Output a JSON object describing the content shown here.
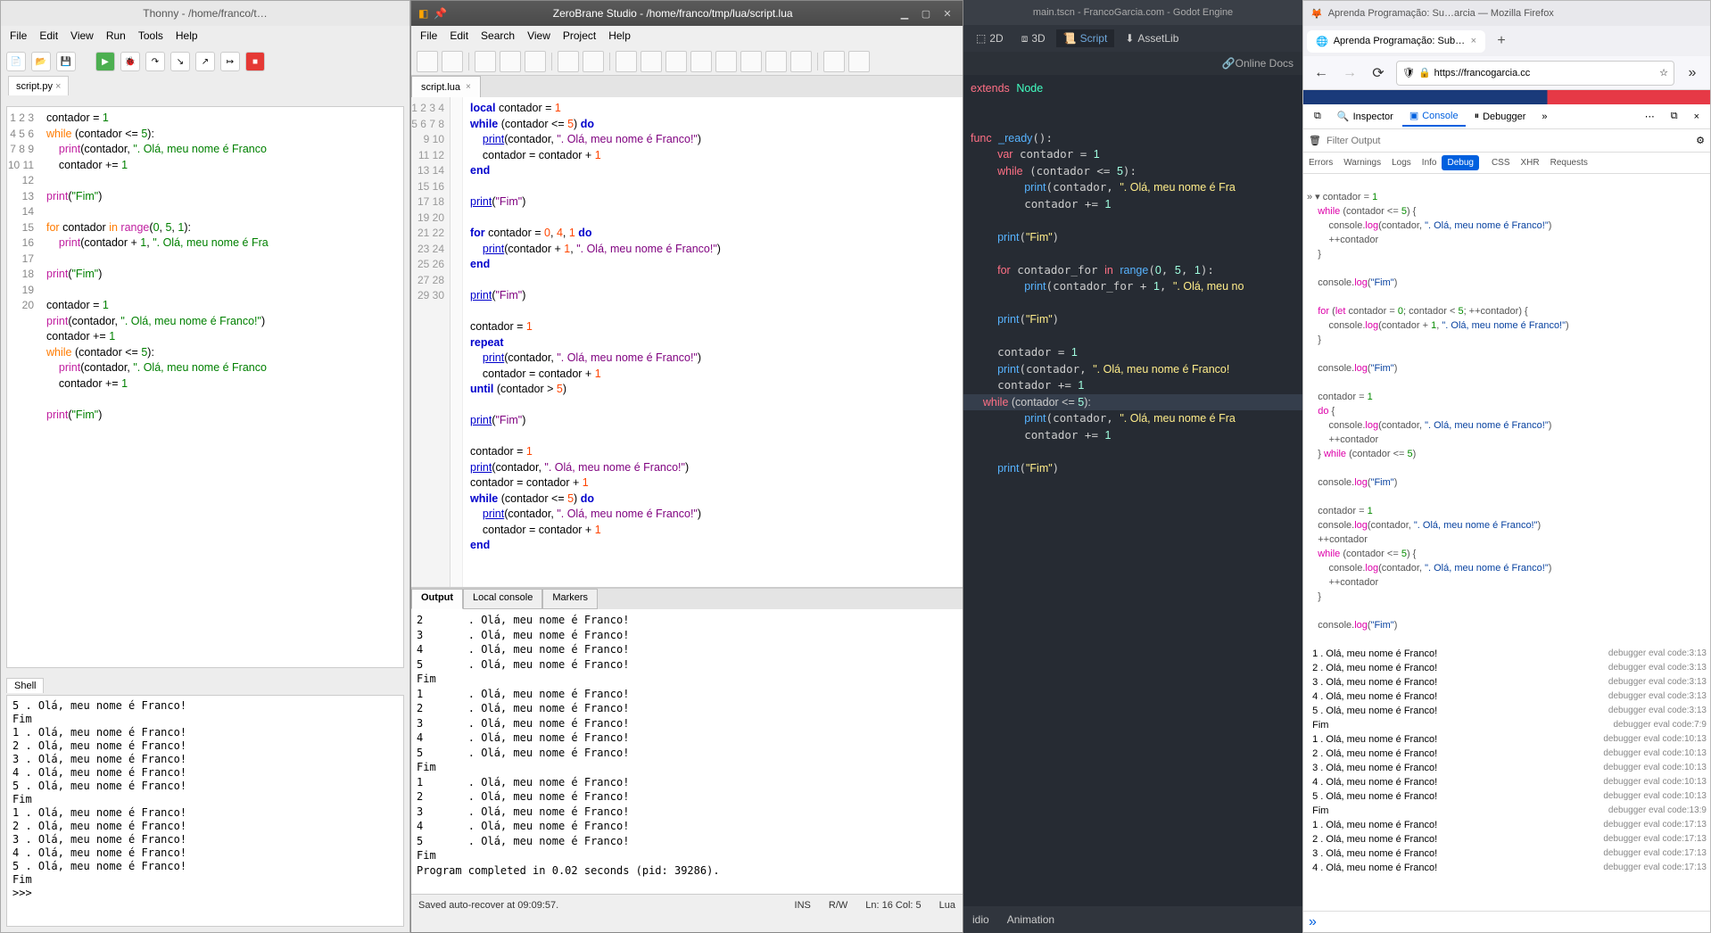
{
  "thonny": {
    "title": "Thonny - /home/franco/t…",
    "menu": [
      "File",
      "Edit",
      "View",
      "Run",
      "Tools",
      "Help"
    ],
    "tab": "script.py",
    "gutter": [
      "1",
      "2",
      "3",
      "4",
      "5",
      "6",
      "7",
      "8",
      "9",
      "10",
      "11",
      "12",
      "13",
      "14",
      "15",
      "16",
      "17",
      "18",
      "19",
      "20"
    ],
    "shell_tab": "Shell",
    "shell_text": "5 . Olá, meu nome é Franco!\nFim\n1 . Olá, meu nome é Franco!\n2 . Olá, meu nome é Franco!\n3 . Olá, meu nome é Franco!\n4 . Olá, meu nome é Franco!\n5 . Olá, meu nome é Franco!\nFim\n1 . Olá, meu nome é Franco!\n2 . Olá, meu nome é Franco!\n3 . Olá, meu nome é Franco!\n4 . Olá, meu nome é Franco!\n5 . Olá, meu nome é Franco!\nFim\n>>> "
  },
  "zerobrane": {
    "title": "ZeroBrane Studio - /home/franco/tmp/lua/script.lua",
    "menu": [
      "File",
      "Edit",
      "Search",
      "View",
      "Project",
      "Help"
    ],
    "tab": "script.lua",
    "gutter": [
      "1",
      "2",
      "3",
      "4",
      "5",
      "6",
      "7",
      "8",
      "9",
      "10",
      "11",
      "12",
      "13",
      "14",
      "15",
      "16",
      "17",
      "18",
      "19",
      "20",
      "21",
      "22",
      "23",
      "24",
      "25",
      "26",
      "27",
      "28",
      "29",
      "30"
    ],
    "out_tabs": [
      "Output",
      "Local console",
      "Markers"
    ],
    "output_text": "2       . Olá, meu nome é Franco!\n3       . Olá, meu nome é Franco!\n4       . Olá, meu nome é Franco!\n5       . Olá, meu nome é Franco!\nFim\n1       . Olá, meu nome é Franco!\n2       . Olá, meu nome é Franco!\n3       . Olá, meu nome é Franco!\n4       . Olá, meu nome é Franco!\n5       . Olá, meu nome é Franco!\nFim\n1       . Olá, meu nome é Franco!\n2       . Olá, meu nome é Franco!\n3       . Olá, meu nome é Franco!\n4       . Olá, meu nome é Franco!\n5       . Olá, meu nome é Franco!\nFim\nProgram completed in 0.02 seconds (pid: 39286).",
    "status": {
      "saved": "Saved auto-recover at 09:09:57.",
      "ins": "INS",
      "rw": "R/W",
      "pos": "Ln: 16 Col: 5",
      "lang": "Lua"
    }
  },
  "godot": {
    "title": "main.tscn - FrancoGarcia.com - Godot Engine",
    "topbar": {
      "2d": "2D",
      "3d": "3D",
      "script": "Script",
      "assetlib": "AssetLib"
    },
    "online": "Online Docs",
    "bottom": {
      "idio": "idio",
      "animation": "Animation"
    }
  },
  "firefox": {
    "title": "Aprenda Programação: Su…arcia — Mozilla Firefox",
    "tab": "Aprenda Programação: Subr…",
    "url": "https://francogarcia.cc",
    "devtabs": {
      "inspector": "Inspector",
      "console": "Console",
      "debugger": "Debugger"
    },
    "filter_placeholder": "Filter Output",
    "cats": [
      "Errors",
      "Warnings",
      "Logs",
      "Info",
      "Debug",
      "CSS",
      "XHR",
      "Requests"
    ],
    "console_rows": [
      {
        "l": "1 . Olá, meu nome é Franco!",
        "r": "debugger eval code:3:13"
      },
      {
        "l": "2 . Olá, meu nome é Franco!",
        "r": "debugger eval code:3:13"
      },
      {
        "l": "3 . Olá, meu nome é Franco!",
        "r": "debugger eval code:3:13"
      },
      {
        "l": "4 . Olá, meu nome é Franco!",
        "r": "debugger eval code:3:13"
      },
      {
        "l": "5 . Olá, meu nome é Franco!",
        "r": "debugger eval code:3:13"
      },
      {
        "l": "Fim",
        "r": "debugger eval code:7:9"
      },
      {
        "l": "1 . Olá, meu nome é Franco!",
        "r": "debugger eval code:10:13"
      },
      {
        "l": "2 . Olá, meu nome é Franco!",
        "r": "debugger eval code:10:13"
      },
      {
        "l": "3 . Olá, meu nome é Franco!",
        "r": "debugger eval code:10:13"
      },
      {
        "l": "4 . Olá, meu nome é Franco!",
        "r": "debugger eval code:10:13"
      },
      {
        "l": "5 . Olá, meu nome é Franco!",
        "r": "debugger eval code:10:13"
      },
      {
        "l": "Fim",
        "r": "debugger eval code:13:9"
      },
      {
        "l": "1 . Olá, meu nome é Franco!",
        "r": "debugger eval code:17:13"
      },
      {
        "l": "2 . Olá, meu nome é Franco!",
        "r": "debugger eval code:17:13"
      },
      {
        "l": "3 . Olá, meu nome é Franco!",
        "r": "debugger eval code:17:13"
      },
      {
        "l": "4 . Olá, meu nome é Franco!",
        "r": "debugger eval code:17:13"
      }
    ]
  }
}
